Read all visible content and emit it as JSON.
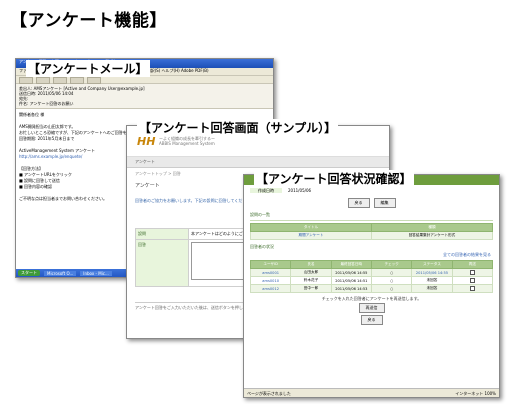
{
  "page_title": "【アンケート機能】",
  "mail": {
    "label": "【アンケートメール】",
    "window_title": "アンケート回答のお願い - メッセージ (テキスト形式)",
    "menu": "ファイル(F)  編集(E)  表示(V)  挿入(I)  書式(O)  ツール(T)  アクション(A)  翻訳(S)  ヘルプ(H)  Adobe PDF(B)",
    "header_from": "差出人:  AMSアンケート  [Active and Company User@example.jp]",
    "header_date": "送信日時: 2011/05/06 14:04",
    "header_to": "宛先:",
    "header_subject": "件名:  アンケート回答のお願い",
    "body_lines": [
      "関係者各位 様",
      "",
      "AMS開発担当の山田太郎です。",
      "お忙しいところ恐縮ですが、下記のアンケートへのご回答をお願いいたします。",
      "回答期限: 2011年5月末日まで",
      "",
      "ActiveManagement System アンケート",
      "http://ams.example.jp/enquete/",
      "",
      "【回答方法】",
      "■ アンケートURLをクリック",
      "■ 設問に回答して送信",
      "■ 回答内容の確認",
      "",
      "ご不明な点は担当者までお問い合わせください。"
    ],
    "taskbar_start": "スタート",
    "taskbar_tasks": [
      "Microsoft O...",
      "Inbox - Mic..."
    ]
  },
  "form": {
    "label": "【アンケート回答画面（サンプル）】",
    "logo": "HH",
    "logo_line1": "ーよく組織の成長を牽引するー",
    "logo_line2": "ABBIS Management System",
    "section": "アンケート",
    "crumb": "アンケートトップ > 回答",
    "sub_title": "アンケート",
    "intro": "回答者のご協力をお願いします。下記の設問に回答してください。",
    "question_label": "設問",
    "question_text": "本アンケートはどのようにご利用いただいていますか",
    "answer_label": "回答",
    "answer_placeholder": "",
    "note": "アンケート回答をご入力いただいた後は、送信ボタンを押してください。"
  },
  "status": {
    "label": "【アンケート回答状況確認】",
    "created_label": "作成日時",
    "created_value": "2011/05/06",
    "btn_back": "戻る",
    "btn_edit": "編集",
    "list_title": "設問の一覧",
    "q_header": [
      "タイトル",
      "種類"
    ],
    "q_row": [
      "期間アンケート",
      "回答結果集計アンケート形式"
    ],
    "answer_title": "回答者の状況",
    "all_link": "全ての回答者の結果を見る",
    "headers": [
      "ユーザID",
      "氏名",
      "最終回答日時",
      "チェック",
      "ステータス",
      "再送"
    ],
    "rows": [
      [
        "ams0001",
        "山田太郎",
        "2011/05/06 14:55",
        "○",
        "2011/05/06 14:55",
        ""
      ],
      [
        "ams0010",
        "鈴木花子",
        "2011/05/06 14:51",
        "○",
        "未回答",
        ""
      ],
      [
        "ams0012",
        "田中一郎",
        "2011/05/06 14:53",
        "○",
        "未回答",
        ""
      ]
    ],
    "msg": "チェックを入れた回答者にアンケートを再送信します。",
    "btn_resend": "再送信",
    "btn_back2": "戻る",
    "status_left": "ページが表示されました",
    "status_right": "インターネット   100%"
  }
}
